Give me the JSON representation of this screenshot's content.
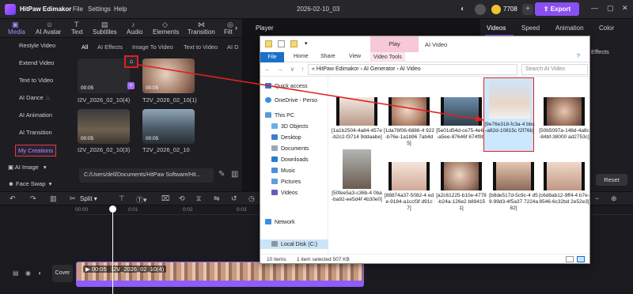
{
  "titlebar": {
    "app_name": "HitPaw Edimakor",
    "menu": [
      "File",
      "Settings",
      "Help"
    ],
    "project_title": "2026-02-10_03",
    "coins": "7708",
    "export_label": "Export",
    "min": "—",
    "max": "▢",
    "close": "✕"
  },
  "tools": [
    "Media",
    "AI Avatar",
    "Text",
    "Subtitles",
    "Audio",
    "Elements",
    "Transition",
    "Filt"
  ],
  "leftnav": {
    "items": [
      "Restyle Video",
      "Extend Video",
      "Text to Video",
      "AI Dance",
      "AI Animation",
      "AI Transition"
    ],
    "active_item": "My Creations",
    "groups": [
      "AI Image",
      "Face Swap"
    ]
  },
  "media": {
    "subtabs": [
      "All",
      "AI Effects",
      "Image To Video",
      "Text to Video",
      "AI D"
    ],
    "thumbs": [
      {
        "time": "00:05",
        "label": "I2V_2026_02_10(4)"
      },
      {
        "time": "00:05",
        "label": "T2V_2026_02_10(1)"
      },
      {
        "time": "00:05",
        "label": "I2V_2026_02_10(3)"
      },
      {
        "time": "00:05",
        "label": "T2V_2026_02_10"
      }
    ],
    "path": "C:/Users/dell/Documents/HitPaw Software/Hit..."
  },
  "player": {
    "title": "Player"
  },
  "rightpanel": {
    "tabs": [
      "Videos",
      "Speed",
      "Animation",
      "Color"
    ],
    "effects": "Effects",
    "reset": "Reset"
  },
  "timeline": {
    "split": "Split",
    "ruler": [
      "00:00",
      "0:01",
      "0:02",
      "0:03",
      "0:04",
      "0:05",
      "0:06",
      "0:07",
      "0:08",
      "0:09"
    ],
    "cover": "Cover",
    "clip_time": "00:05",
    "clip_name": "I2V_2026_02_10(4)"
  },
  "explorer": {
    "play_ctx": "Play",
    "title": "AI Video",
    "ribbon": [
      "File",
      "Home",
      "Share",
      "View",
      "Video Tools"
    ],
    "address": "«  HitPaw Edimakor  ›  AI Generator  ›  AI Video",
    "search_placeholder": "Search AI Video",
    "nav": [
      "Quick access",
      "OneDrive - Perso",
      "This PC",
      "3D Objects",
      "Desktop",
      "Documents",
      "Downloads",
      "Music",
      "Pictures",
      "Videos",
      "Local Disk (C:)",
      "Network"
    ],
    "files": [
      "[1a1b2504-4a84-457e-b2c2-f3714 9ddaabe]",
      "[1da76f06-6886-4 922-b76e-1a1b96 7ab4d5]",
      "[5e01d54d-ce75-4e67-a5ee-87646f 674f9b]",
      "[9e76e318-fc3a-4 bbc-a82d-10815c f2f76b]",
      "[50b5097a-148d-4a8c-84bf-38000 ad2753c]",
      "[50fee5a3-c36b-4 0ba-ba92-ee5d4f 4b30e0]",
      "[88874a37-5082-4 ede-9184-a1ccf3f d91c7]",
      "[a2c61225-b10e-4778-b24a-126e2 b894151]",
      "[b8de517d-5c9c-4 d59-99d3-4f5a37 7224a82]",
      "[c6d8ab12-9ff4-4 b7e-8546-6c32bd 2e52e3]"
    ],
    "status_count": "10 items",
    "status_sel": "1 item selected  507 KB"
  }
}
